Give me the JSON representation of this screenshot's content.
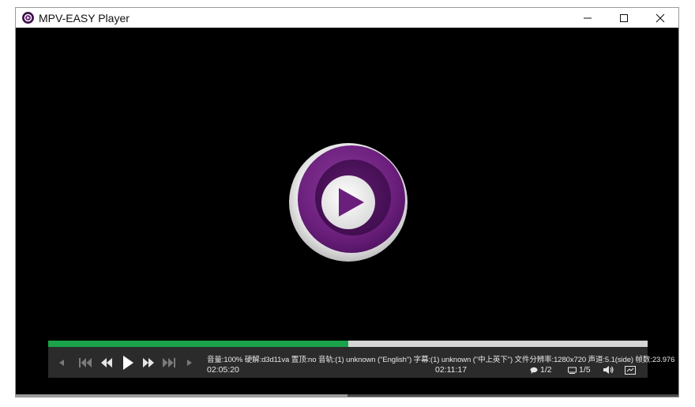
{
  "window": {
    "title": "MPV-EASY Player",
    "icons": {
      "app": "mpv-logo-icon",
      "minimize": "minimize-icon",
      "maximize": "maximize-icon",
      "close": "close-icon"
    }
  },
  "player": {
    "center_logo": "mpv-play-logo",
    "progress_fraction": 0.5,
    "bottom_scroll_fraction": 0.5
  },
  "controls": {
    "icons": [
      "prev-chapter-icon",
      "skip-back-icon",
      "rewind-icon",
      "play-icon",
      "fast-forward-icon",
      "skip-forward-icon",
      "next-chapter-icon"
    ],
    "info_line": "音量:100%  硬解:d3d11va  置顶:no  音轨:(1) unknown (\"English\")  字幕:(1) unknown (\"中上英下\")  文件分辨率:1280x720  声道:5.1(side)  帧数:23.976",
    "current_time": "02:05:20",
    "total_time": "02:11:17",
    "subtitle_track": "1/2",
    "audio_track": "1/5"
  },
  "colors": {
    "accent_green": "#1aa34a",
    "osc_bg": "#2b2b2b",
    "logo_purple": "#6b1f7c"
  }
}
